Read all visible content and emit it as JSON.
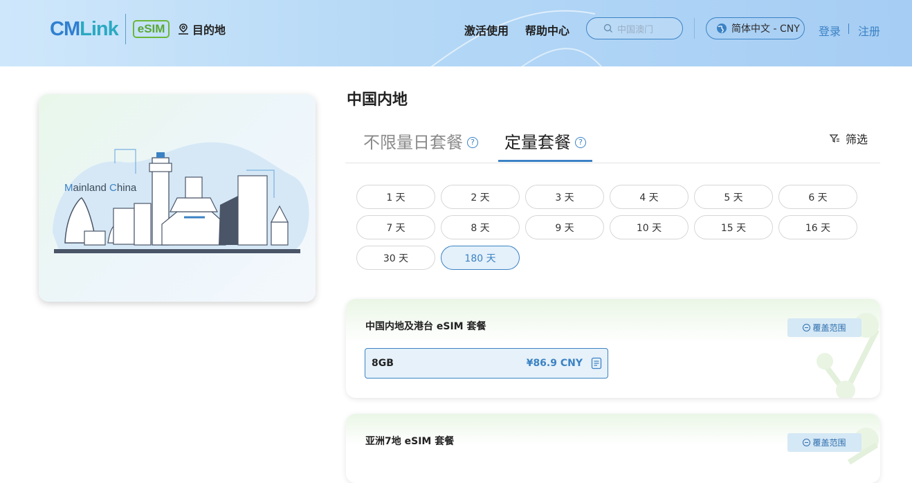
{
  "header": {
    "logo_cm": "CM",
    "logo_link": "Link",
    "logo_esim": "eSIM",
    "destination_label": "目的地",
    "nav": [
      "激活使用",
      "帮助中心"
    ],
    "search_placeholder": "中国澳门",
    "language": "简体中文 - CNY",
    "login": "登录",
    "register": "注册"
  },
  "hero": {
    "caption_m": "M",
    "caption_rest1": "ainland ",
    "caption_c": "C",
    "caption_rest2": "hina"
  },
  "main": {
    "title": "中国内地",
    "tabs": [
      {
        "label": "不限量日套餐",
        "active": false
      },
      {
        "label": "定量套餐",
        "active": true
      }
    ],
    "filter_label": "筛选",
    "durations": [
      "1 天",
      "2 天",
      "3 天",
      "4 天",
      "5 天",
      "6 天",
      "7 天",
      "8 天",
      "9 天",
      "10 天",
      "15 天",
      "16 天",
      "30 天",
      "180 天"
    ],
    "selected_duration": "180 天",
    "packages": [
      {
        "title": "中国内地及港台 eSIM 套餐",
        "coverage": "覆盖范围",
        "plan": {
          "data": "8GB",
          "price": "¥86.9 CNY"
        }
      },
      {
        "title": "亚洲7地 eSIM 套餐",
        "coverage": "覆盖范围"
      }
    ]
  },
  "colors": {
    "accent": "#3b82c4",
    "selected_bg": "#e4f0fa",
    "header_bg": "#b4d8f6",
    "esim_green": "#5aa734"
  }
}
